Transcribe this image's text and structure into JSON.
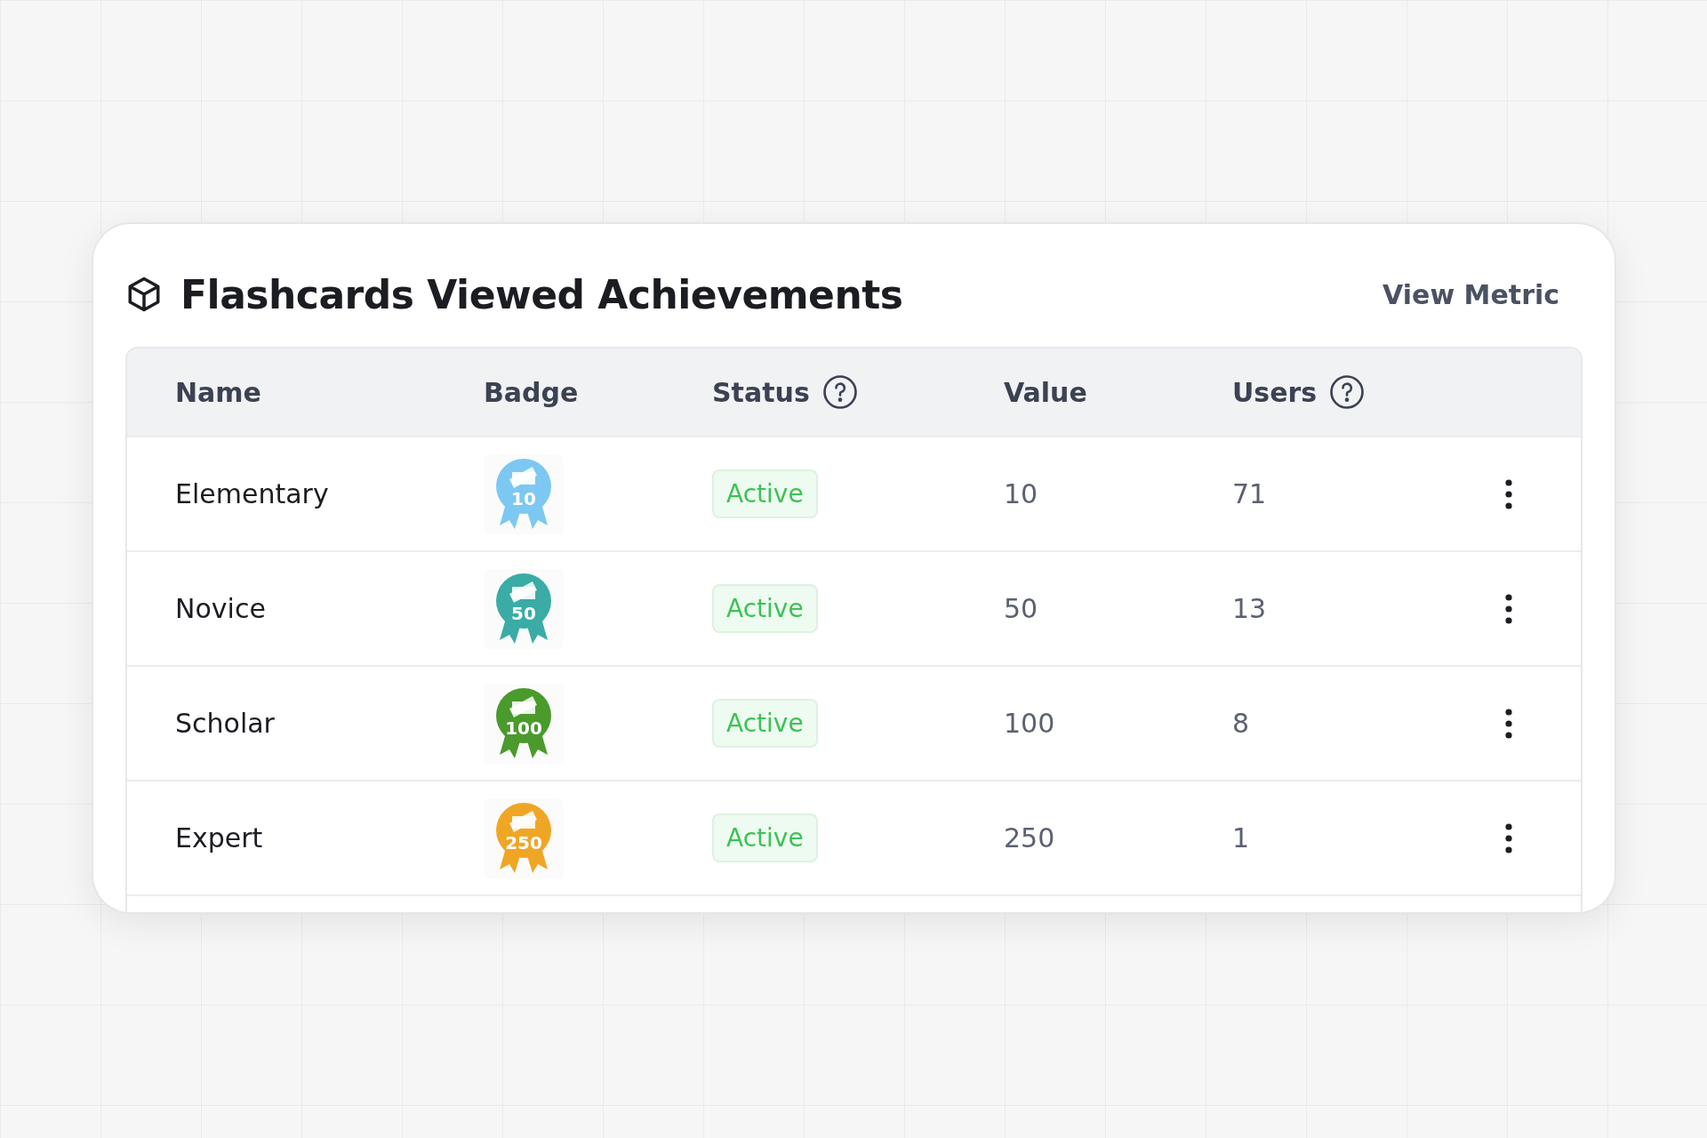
{
  "card": {
    "title": "Flashcards Viewed Achievements",
    "action": "View Metric"
  },
  "table": {
    "columns": [
      {
        "label": "Name",
        "help": false
      },
      {
        "label": "Badge",
        "help": false
      },
      {
        "label": "Status",
        "help": true
      },
      {
        "label": "Value",
        "help": false
      },
      {
        "label": "Users",
        "help": true
      }
    ],
    "rows": [
      {
        "name": "Elementary",
        "badge": {
          "number": "10",
          "color": "#7cc8f2"
        },
        "status": "Active",
        "value": "10",
        "users": "71"
      },
      {
        "name": "Novice",
        "badge": {
          "number": "50",
          "color": "#3aaca5"
        },
        "status": "Active",
        "value": "50",
        "users": "13"
      },
      {
        "name": "Scholar",
        "badge": {
          "number": "100",
          "color": "#4a9a2c"
        },
        "status": "Active",
        "value": "100",
        "users": "8"
      },
      {
        "name": "Expert",
        "badge": {
          "number": "250",
          "color": "#f0a625"
        },
        "status": "Active",
        "value": "250",
        "users": "1"
      }
    ]
  }
}
